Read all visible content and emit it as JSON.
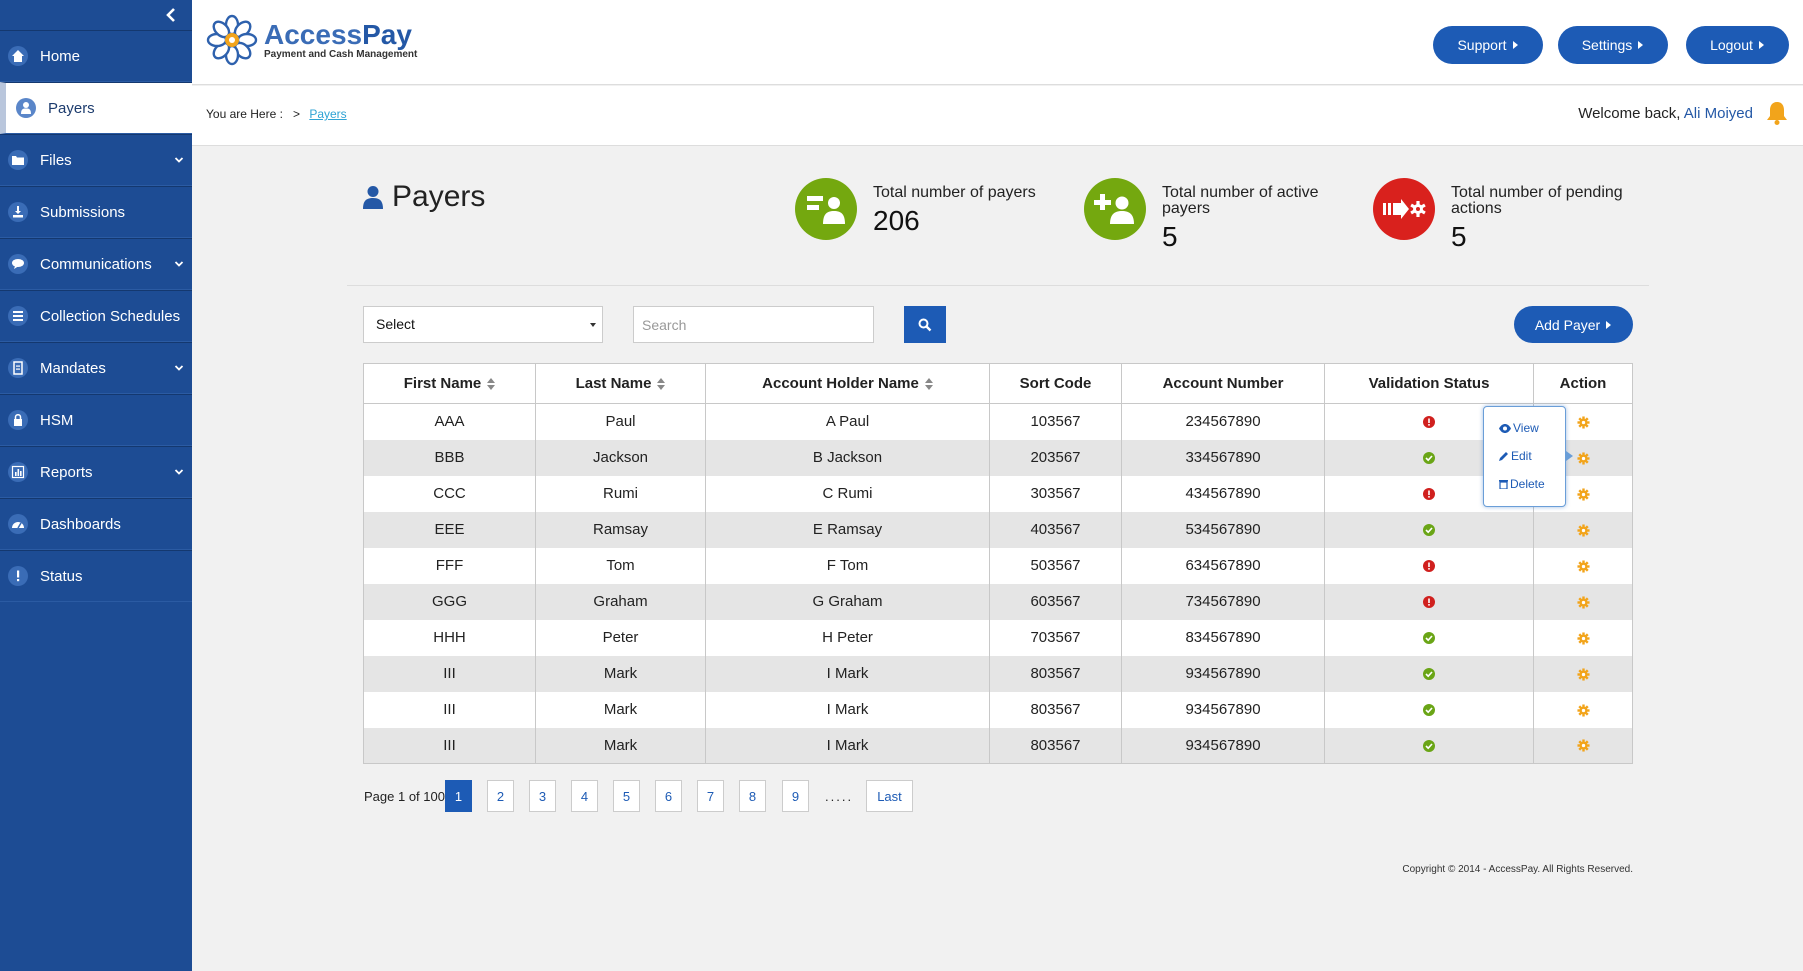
{
  "sidebar": {
    "items": [
      {
        "label": "Home",
        "icon": "home-icon"
      },
      {
        "label": "Payers",
        "icon": "user-icon",
        "active": true
      },
      {
        "label": "Files",
        "icon": "folder-icon",
        "expandable": true
      },
      {
        "label": "Submissions",
        "icon": "download-icon"
      },
      {
        "label": "Communications",
        "icon": "chat-icon",
        "expandable": true
      },
      {
        "label": "Collection Schedules",
        "icon": "list-icon"
      },
      {
        "label": "Mandates",
        "icon": "document-icon",
        "expandable": true
      },
      {
        "label": "HSM",
        "icon": "lock-icon"
      },
      {
        "label": "Reports",
        "icon": "bar-chart-icon",
        "expandable": true
      },
      {
        "label": "Dashboards",
        "icon": "dashboard-icon"
      },
      {
        "label": "Status",
        "icon": "exclamation-icon"
      }
    ]
  },
  "header": {
    "logo_name_a": "Access",
    "logo_name_b": "Pay",
    "logo_sub": "Payment and Cash Management",
    "buttons": {
      "support": "Support",
      "settings": "Settings",
      "logout": "Logout"
    }
  },
  "breadcrumb": {
    "prefix": "You are Here :",
    "sep": ">",
    "current": "Payers"
  },
  "welcome": {
    "text": "Welcome back,",
    "user": "Ali Moiyed"
  },
  "page": {
    "title": "Payers"
  },
  "stats": [
    {
      "label": "Total number of payers",
      "value": "206",
      "color": "#74a80f"
    },
    {
      "label": "Total number of active payers",
      "value": "5",
      "color": "#74a80f"
    },
    {
      "label": "Total number of pending actions",
      "value": "5",
      "color": "#d9211d"
    }
  ],
  "controls": {
    "select_value": "Select",
    "search_placeholder": "Search",
    "add_label": "Add Payer"
  },
  "table": {
    "headers": [
      "First Name",
      "Last Name",
      "Account Holder Name",
      "Sort Code",
      "Account Number",
      "Validation Status",
      "Action"
    ],
    "rows": [
      {
        "first": "AAA",
        "last": "Paul",
        "holder": "A Paul",
        "sort": "103567",
        "account": "234567890",
        "status": "error"
      },
      {
        "first": "BBB",
        "last": "Jackson",
        "holder": "B Jackson",
        "sort": "203567",
        "account": "334567890",
        "status": "ok"
      },
      {
        "first": "CCC",
        "last": "Rumi",
        "holder": "C Rumi",
        "sort": "303567",
        "account": "434567890",
        "status": "error"
      },
      {
        "first": "EEE",
        "last": "Ramsay",
        "holder": "E Ramsay",
        "sort": "403567",
        "account": "534567890",
        "status": "ok"
      },
      {
        "first": "FFF",
        "last": "Tom",
        "holder": "F Tom",
        "sort": "503567",
        "account": "634567890",
        "status": "error"
      },
      {
        "first": "GGG",
        "last": "Graham",
        "holder": "G Graham",
        "sort": "603567",
        "account": "734567890",
        "status": "error"
      },
      {
        "first": "HHH",
        "last": "Peter",
        "holder": "H Peter",
        "sort": "703567",
        "account": "834567890",
        "status": "ok"
      },
      {
        "first": "III",
        "last": "Mark",
        "holder": "I Mark",
        "sort": "803567",
        "account": "934567890",
        "status": "ok"
      },
      {
        "first": "III",
        "last": "Mark",
        "holder": "I Mark",
        "sort": "803567",
        "account": "934567890",
        "status": "ok"
      },
      {
        "first": "III",
        "last": "Mark",
        "holder": "I Mark",
        "sort": "803567",
        "account": "934567890",
        "status": "ok"
      }
    ]
  },
  "popup": {
    "view": "View",
    "edit": "Edit",
    "delete": "Delete"
  },
  "pagination": {
    "info": "Page 1 of 100",
    "pages": [
      "1",
      "2",
      "3",
      "4",
      "5",
      "6",
      "7",
      "8",
      "9"
    ],
    "dots": ".....",
    "last": "Last"
  },
  "footer": {
    "copyright": "Copyright © 2014 - AccessPay. All Rights Reserved."
  }
}
